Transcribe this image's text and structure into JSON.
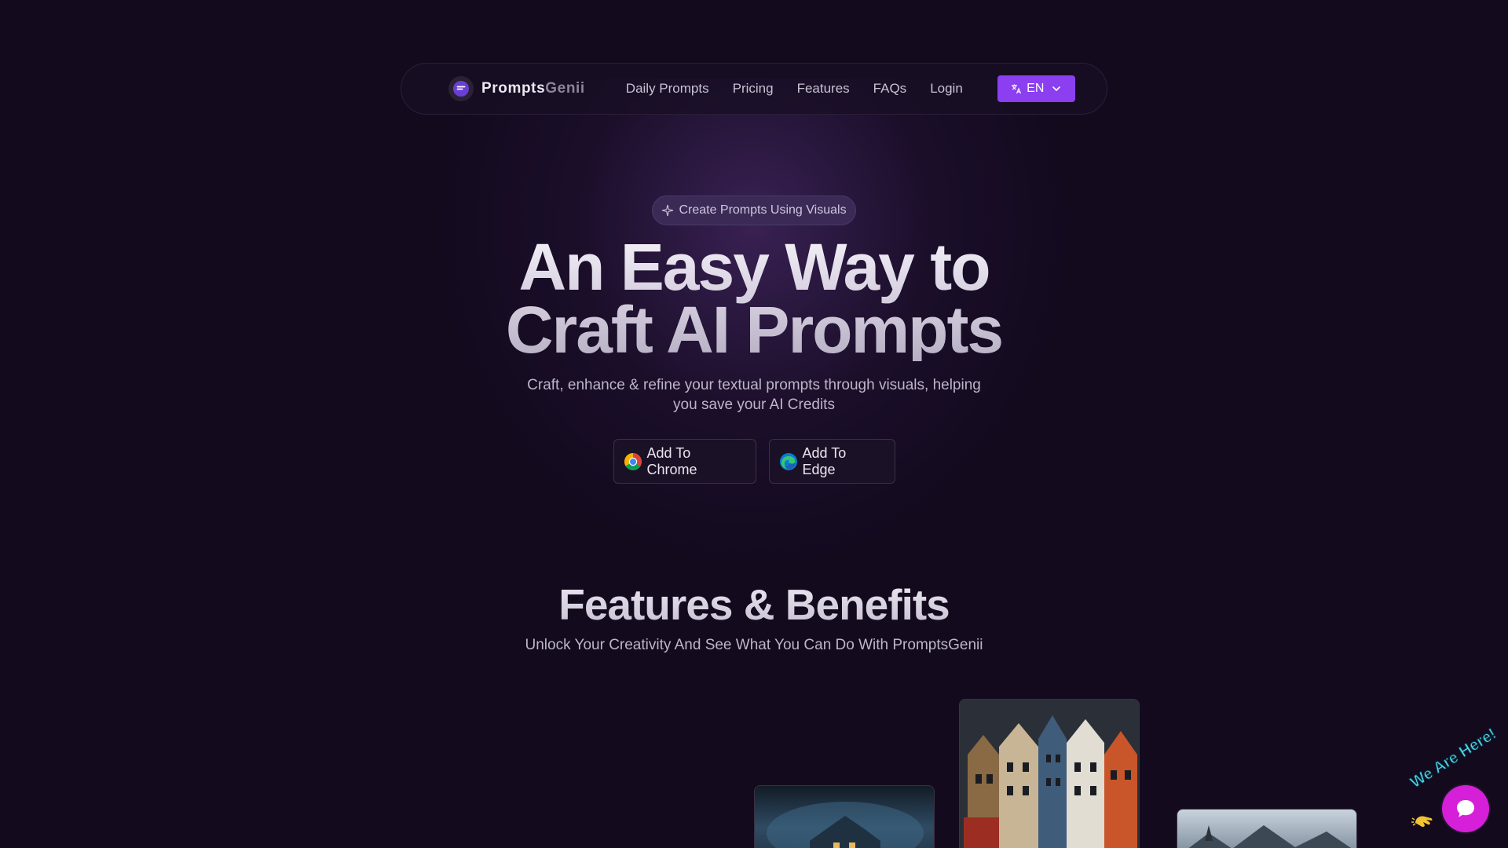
{
  "brand": {
    "name_part1": "Prompts",
    "name_part2": "Genii",
    "logo_icon": "chat-bubble-icon"
  },
  "nav": {
    "links": [
      "Daily Prompts",
      "Pricing",
      "Features",
      "FAQs",
      "Login"
    ],
    "language": {
      "label": "EN",
      "icon": "translate-icon"
    }
  },
  "hero": {
    "badge": "Create Prompts Using Visuals",
    "title_line1": "An Easy Way to",
    "title_line2": "Craft AI Prompts",
    "subtitle_line1": "Craft, enhance & refine your textual prompts through visuals, helping",
    "subtitle_line2": "you save your AI Credits",
    "cta_chrome": "Add To Chrome",
    "cta_edge": "Add To Edge"
  },
  "features": {
    "title": "Features & Benefits",
    "subtitle": "Unlock Your Creativity And See What You Can Do With PromptsGenii"
  },
  "chat_widget": {
    "tagline": "We Are Here!"
  },
  "colors": {
    "background": "#130a1e",
    "accent": "#8b3ff0",
    "chat": "#d51fd8",
    "badge_bg": "#3a2a55"
  }
}
